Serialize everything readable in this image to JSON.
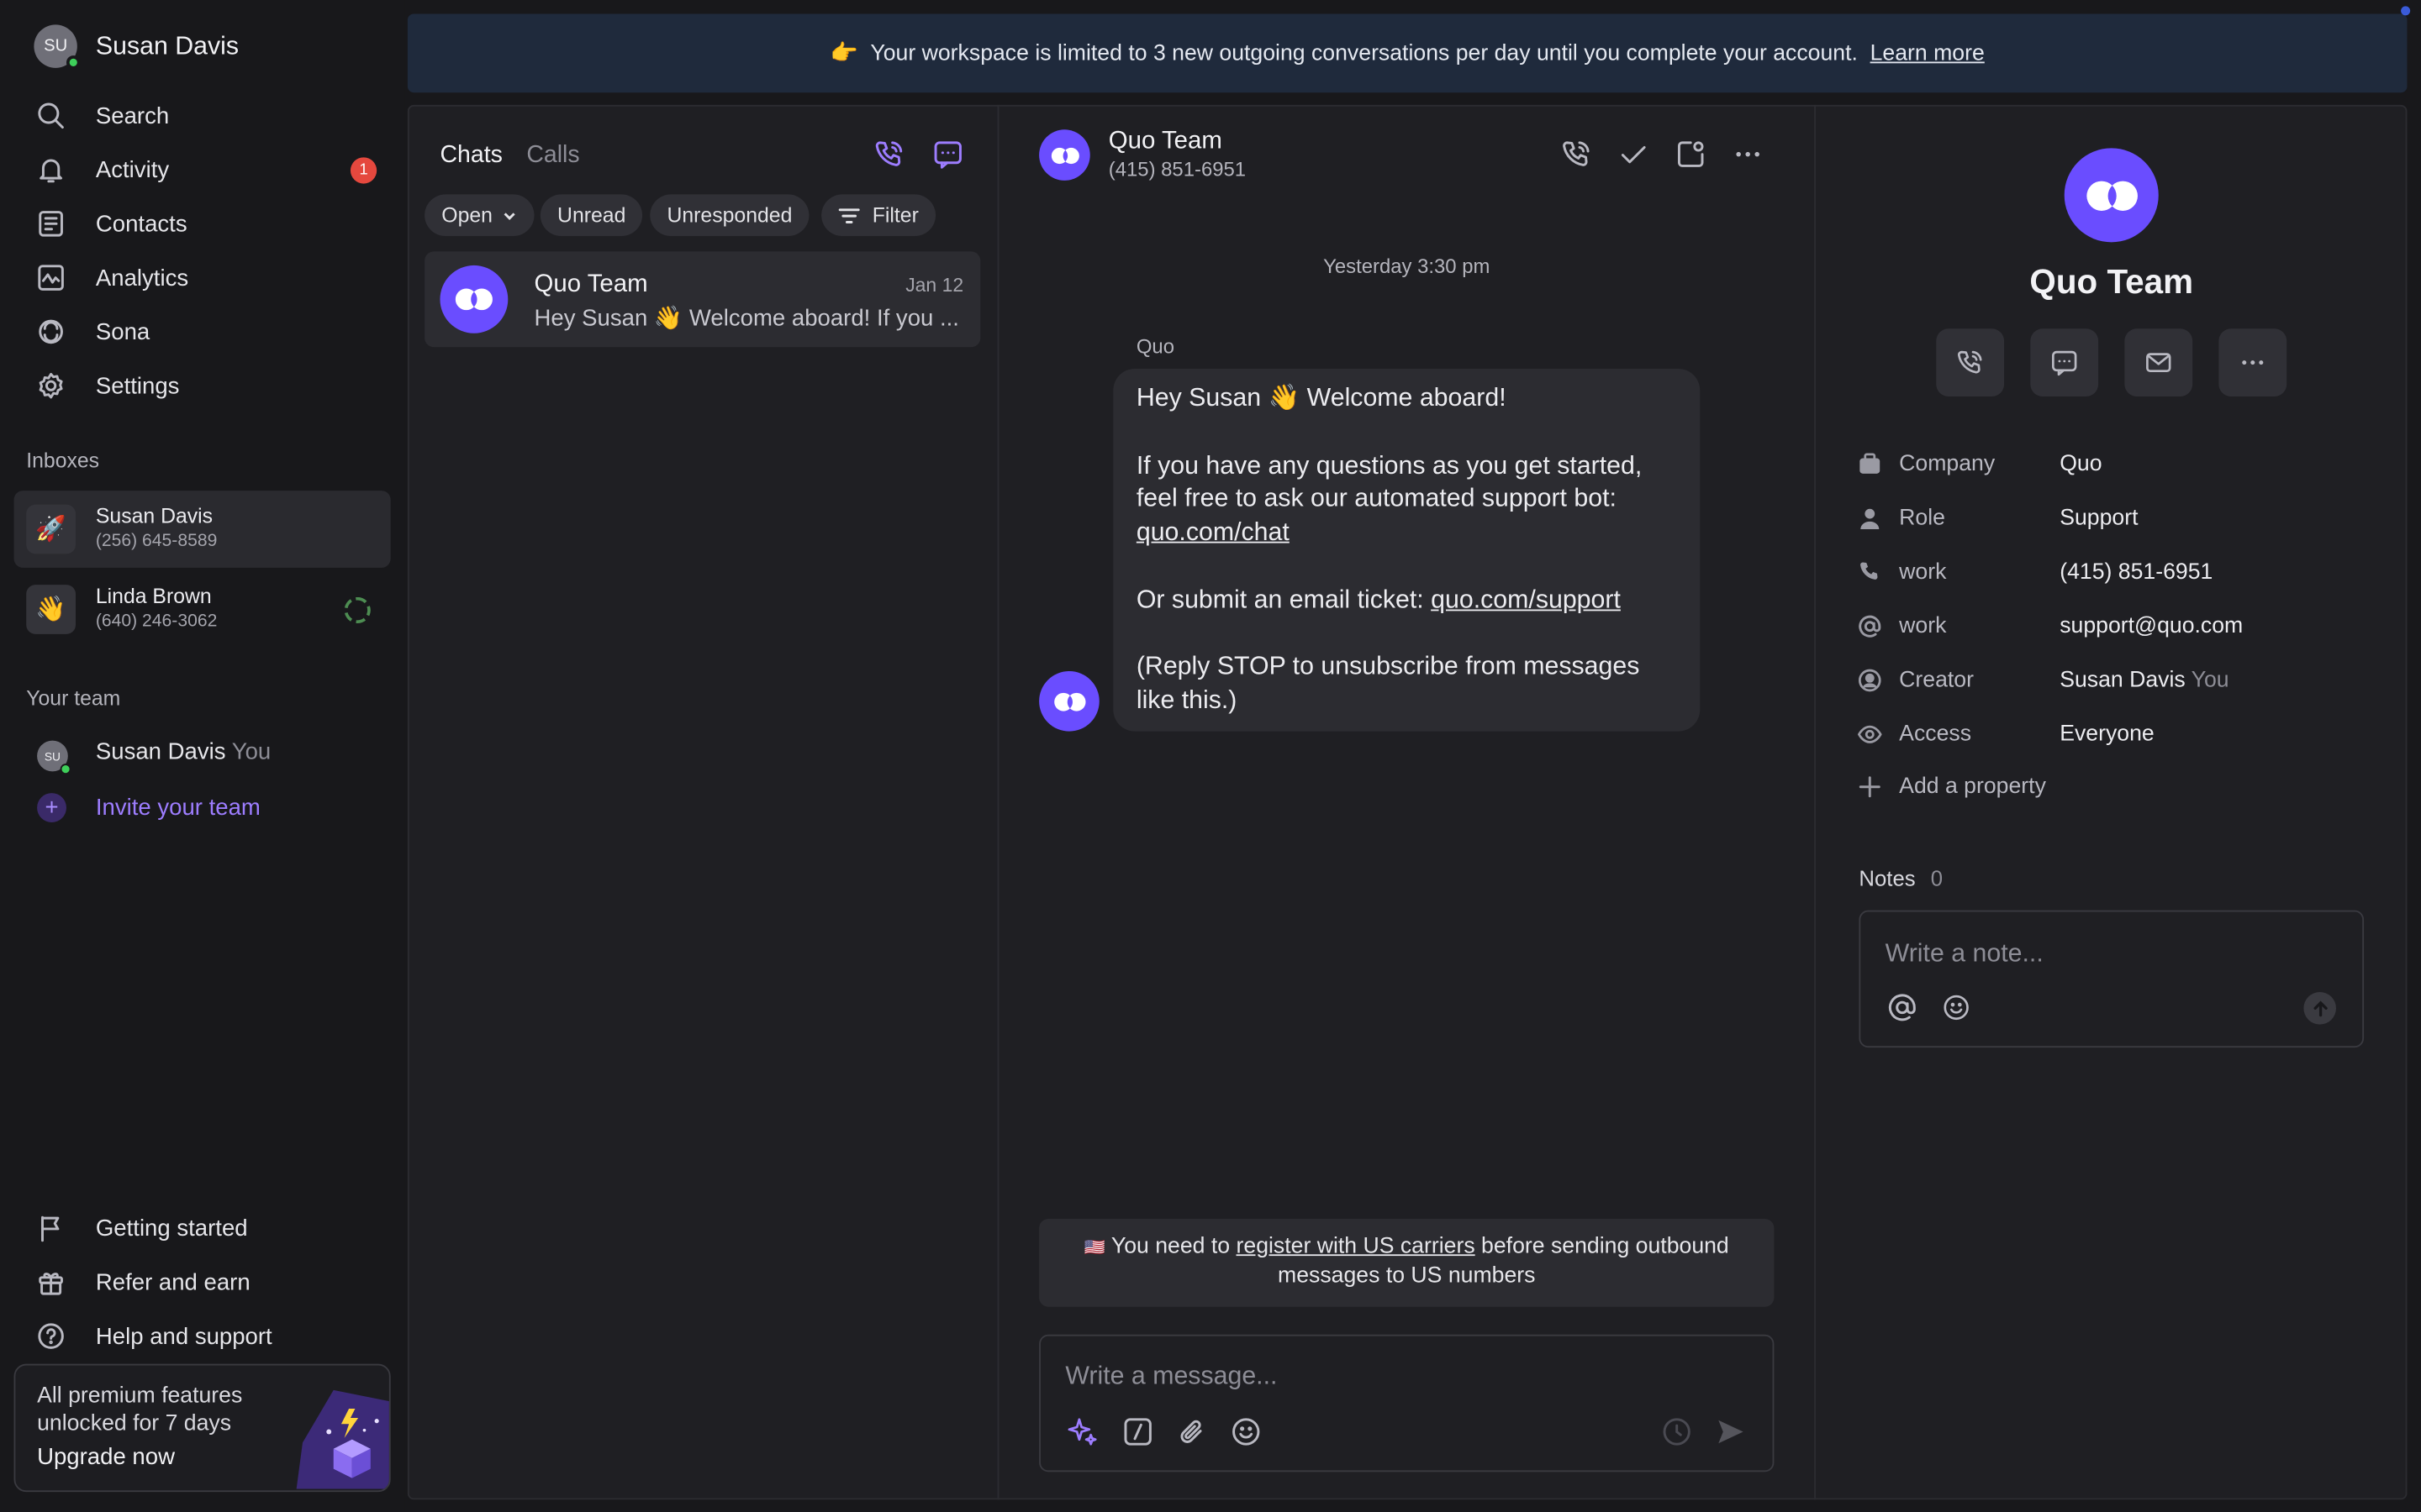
{
  "user": {
    "initials": "SU",
    "name": "Susan Davis"
  },
  "nav": [
    {
      "label": "Search",
      "icon": "search-icon"
    },
    {
      "label": "Activity",
      "icon": "bell-icon",
      "badge": "1"
    },
    {
      "label": "Contacts",
      "icon": "contacts-icon"
    },
    {
      "label": "Analytics",
      "icon": "analytics-icon"
    },
    {
      "label": "Sona",
      "icon": "sona-icon"
    },
    {
      "label": "Settings",
      "icon": "gear-icon"
    }
  ],
  "inboxes_heading": "Inboxes",
  "inboxes": [
    {
      "emoji": "🚀",
      "name": "Susan Davis",
      "phone": "(256) 645-8589"
    },
    {
      "emoji": "👋",
      "name": "Linda Brown",
      "phone": "(640) 246-3062"
    }
  ],
  "team_heading": "Your team",
  "team": [
    {
      "initials": "SU",
      "name": "Susan Davis",
      "tag": "You"
    }
  ],
  "invite_label": "Invite your team",
  "bottom_nav": [
    {
      "label": "Getting started",
      "icon": "flag-icon"
    },
    {
      "label": "Refer and earn",
      "icon": "gift-icon"
    },
    {
      "label": "Help and support",
      "icon": "help-icon"
    }
  ],
  "upgrade": {
    "text": "All premium features unlocked for 7 days",
    "cta": "Upgrade now"
  },
  "banner": {
    "emoji": "👉",
    "text": "Your workspace is limited to 3 new outgoing conversations per day until you complete your account.",
    "link": "Learn more"
  },
  "list": {
    "tabs": [
      "Chats",
      "Calls"
    ],
    "filters": [
      "Open",
      "Unread",
      "Unresponded",
      "Filter"
    ],
    "conversations": [
      {
        "name": "Quo Team",
        "date": "Jan 12",
        "preview": "Hey Susan 👋 Welcome aboard! If you ..."
      }
    ]
  },
  "chat": {
    "contact_name": "Quo Team",
    "contact_phone": "(415) 851-6951",
    "timestamp": "Yesterday 3:30 pm",
    "sender": "Quo",
    "message": {
      "line1": "Hey Susan 👋 Welcome aboard!",
      "para2": "If you have any questions as you get started, feel free to ask our automated support bot:",
      "link1": "quo.com/chat",
      "para3_prefix": "Or submit an email ticket:",
      "link2": "quo.com/support",
      "para4": "(Reply STOP to unsubscribe from messages like this.)"
    },
    "notice": {
      "flag": "🇺🇸",
      "prefix": "You need to",
      "link": "register with US carriers",
      "suffix": "before sending outbound messages to US numbers"
    },
    "composer_placeholder": "Write a message..."
  },
  "contact": {
    "name": "Quo Team",
    "properties": [
      {
        "icon": "building-icon",
        "label": "Company",
        "value": "Quo",
        "tag": ""
      },
      {
        "icon": "person-icon",
        "label": "Role",
        "value": "Support",
        "tag": ""
      },
      {
        "icon": "phone-icon",
        "label": "work",
        "value": "(415) 851-6951",
        "tag": ""
      },
      {
        "icon": "at-icon",
        "label": "work",
        "value": "support@quo.com",
        "tag": ""
      },
      {
        "icon": "creator-icon",
        "label": "Creator",
        "value": "Susan Davis",
        "tag": "You"
      },
      {
        "icon": "eye-icon",
        "label": "Access",
        "value": "Everyone",
        "tag": ""
      }
    ],
    "add_property": "Add a property",
    "notes_label": "Notes",
    "notes_count": "0",
    "note_placeholder": "Write a note..."
  },
  "colors": {
    "accent": "#6a4dff",
    "badge": "#e5483e",
    "online": "#3ecf5a",
    "banner": "#1f2a3c"
  }
}
